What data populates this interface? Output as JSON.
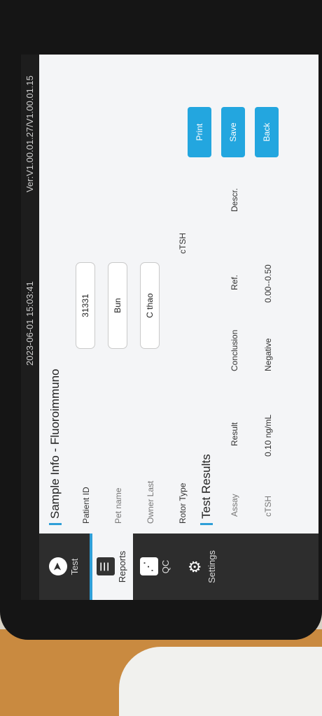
{
  "status": {
    "datetime": "2023-06-01 15:03:41",
    "version": "Ver:V1.00.01.27/V1.00.01.15"
  },
  "sidebar": {
    "items": [
      {
        "label": "Test",
        "icon": "navigation-arrow-icon"
      },
      {
        "label": "Reports",
        "icon": "list-icon"
      },
      {
        "label": "QC",
        "icon": "share-icon"
      },
      {
        "label": "Settings",
        "icon": "gear-icon"
      }
    ],
    "active": "Reports"
  },
  "sample_info": {
    "title": "Sample Info - Fluoroimmuno",
    "patient_id_label": "Patient ID",
    "patient_id_value": "31331",
    "pet_name_label": "Pet name",
    "pet_name_value": "Bun",
    "owner_last_label": "Owner Last",
    "owner_last_value": "C thao",
    "rotor_type_label": "Rotor Type",
    "rotor_type_value": "cTSH"
  },
  "test_results": {
    "title": "Test Results",
    "columns": [
      "Assay",
      "Result",
      "Conclusion",
      "Ref.",
      "Descr."
    ],
    "rows": [
      {
        "assay": "cTSH",
        "result": "0.10 ng/mL",
        "conclusion": "Negative",
        "ref": "0.00--0.50",
        "descr": ""
      }
    ]
  },
  "buttons": {
    "print": "Print",
    "save": "Save",
    "back": "Back"
  },
  "colors": {
    "accent": "#23a6df",
    "sidebar": "#2d2d2d"
  }
}
